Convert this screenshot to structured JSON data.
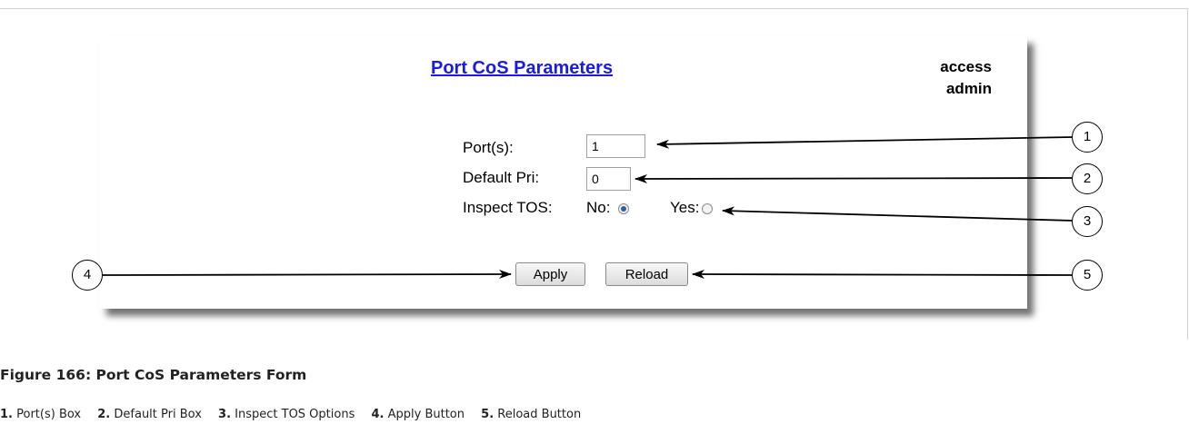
{
  "form": {
    "title": "Port CoS Parameters",
    "access_line1": "access",
    "access_line2": "admin",
    "ports_label": "Port(s):",
    "ports_value": "1",
    "default_pri_label": "Default Pri:",
    "default_pri_value": "0",
    "inspect_tos_label": "Inspect TOS:",
    "no_label": "No:",
    "yes_label": "Yes:",
    "inspect_tos_selected": "No",
    "apply_label": "Apply",
    "reload_label": "Reload"
  },
  "callouts": [
    "1",
    "2",
    "3",
    "4",
    "5"
  ],
  "caption": "Figure 166: Port CoS Parameters Form",
  "legend": [
    {
      "num": "1.",
      "text": "Port(s) Box"
    },
    {
      "num": "2.",
      "text": "Default Pri Box"
    },
    {
      "num": "3.",
      "text": "Inspect TOS Options"
    },
    {
      "num": "4.",
      "text": "Apply Button"
    },
    {
      "num": "5.",
      "text": "Reload Button"
    }
  ]
}
